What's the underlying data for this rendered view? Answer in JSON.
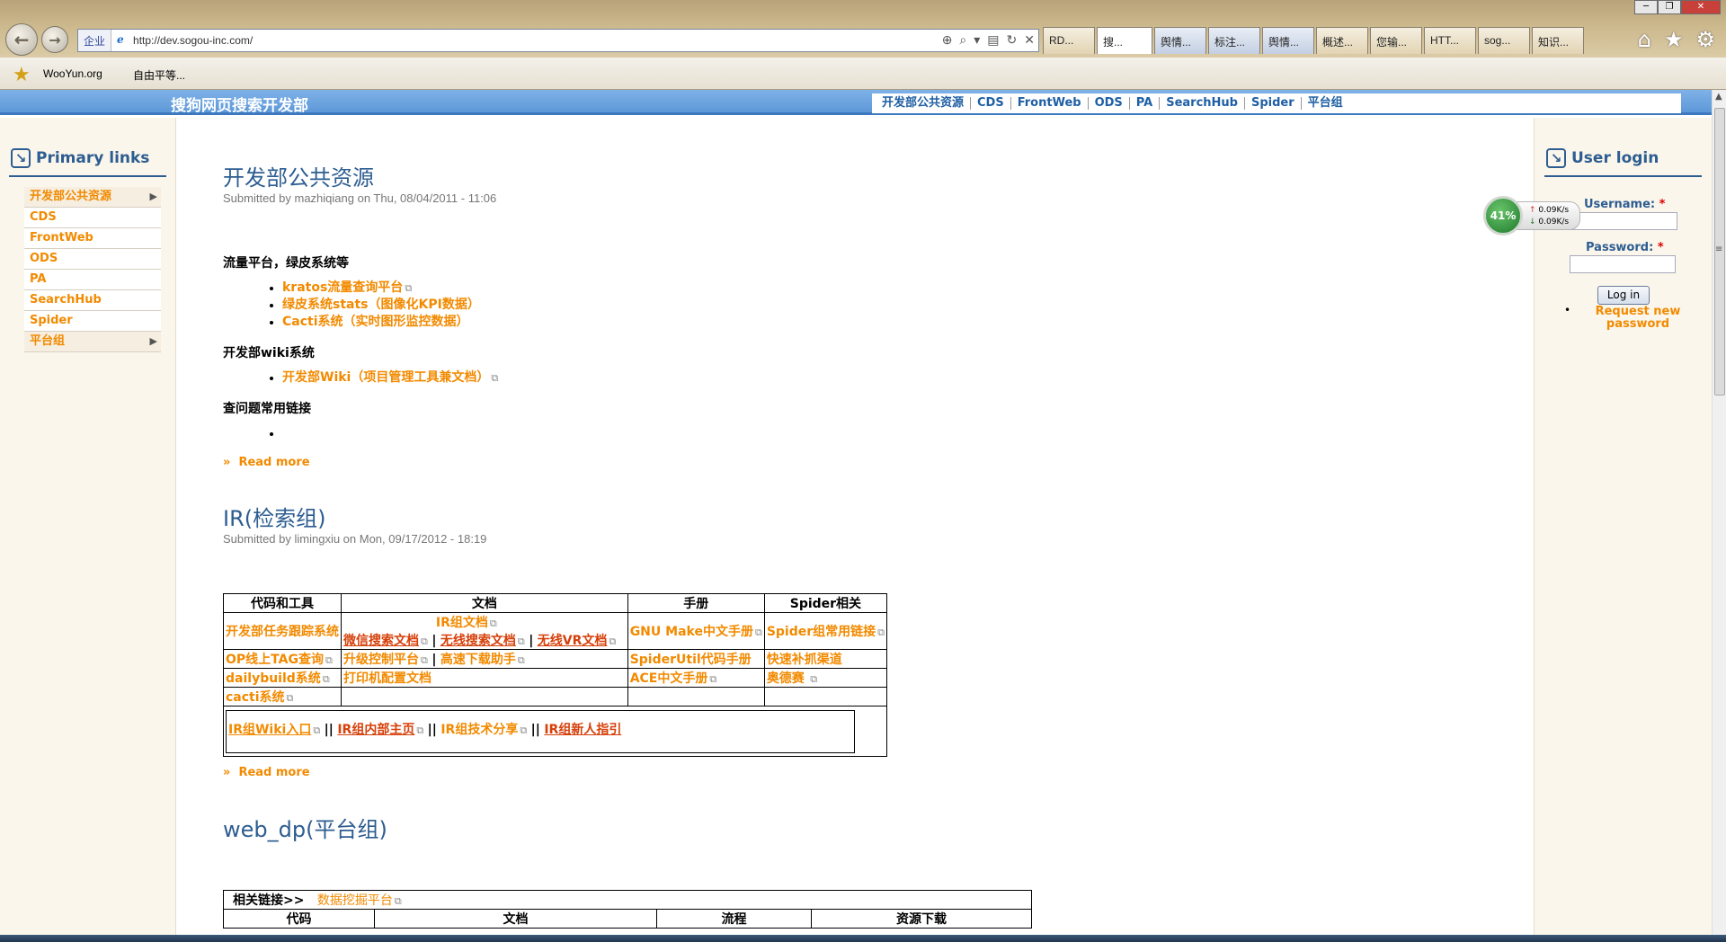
{
  "browser": {
    "address_zone": "企业",
    "url": "http://dev.sogou-inc.com/",
    "tabs": [
      "RD...",
      "搜...",
      "舆情...",
      "标注...",
      "舆情...",
      "概述...",
      "您输...",
      "HTT...",
      "sog...",
      "知识..."
    ],
    "favorites": [
      "WooYun.org",
      "自由平等..."
    ]
  },
  "site": {
    "title": "搜狗网页搜索开发部",
    "topnav": [
      "开发部公共资源",
      "CDS",
      "FrontWeb",
      "ODS",
      "PA",
      "SearchHub",
      "Spider",
      "平台组"
    ]
  },
  "primary_links": {
    "title": "Primary links",
    "items": [
      {
        "label": "开发部公共资源",
        "has_children": true
      },
      {
        "label": "CDS"
      },
      {
        "label": "FrontWeb"
      },
      {
        "label": "ODS"
      },
      {
        "label": "PA"
      },
      {
        "label": "SearchHub"
      },
      {
        "label": "Spider"
      },
      {
        "label": "平台组",
        "has_children": true
      }
    ]
  },
  "user_login": {
    "title": "User login",
    "username_label": "Username:",
    "password_label": "Password:",
    "required_mark": "*",
    "login_button": "Log in",
    "request_password_1": "Request new",
    "request_password_2": "password"
  },
  "netspeed": {
    "percent": "41%",
    "up": "0.09K/s",
    "down": "0.09K/s"
  },
  "nodes": [
    {
      "title": "开发部公共资源",
      "submitted": "Submitted by mazhiqiang on Thu, 08/04/2011 - 11:06",
      "sections": [
        {
          "label": "流量平台，绿皮系统等",
          "links": [
            "kratos流量查询平台",
            "绿皮系统stats（图像化KPI数据）",
            "Cacti系统（实时图形监控数据）"
          ]
        },
        {
          "label": "开发部wiki系统",
          "links": [
            "开发部Wiki（项目管理工具兼文档）"
          ]
        },
        {
          "label": "查问题常用链接",
          "links": [
            ""
          ]
        }
      ],
      "read_more": "Read more"
    },
    {
      "title": "IR(检索组)",
      "submitted": "Submitted by limingxiu on Mon, 09/17/2012 - 18:19",
      "table": {
        "headers": [
          "代码和工具",
          "文档",
          "手册",
          "Spider相关"
        ],
        "r1": {
          "c1": "开发部任务跟踪系统",
          "doc_top": "IR组文档",
          "doc_a": "微信搜索文档",
          "doc_b": "无线搜索文档",
          "doc_c": "无线VR文档",
          "c3": "GNU Make中文手册",
          "c4": "Spider组常用链接"
        },
        "r2": {
          "c1": "OP线上TAG查询",
          "doc_a": "升级控制平台",
          "doc_b": "高速下载助手",
          "c3": "SpiderUtil代码手册",
          "c4": "快速补抓渠道"
        },
        "r3": {
          "c1": "dailybuild系统",
          "doc_a": "打印机配置文档",
          "c3": "ACE中文手册",
          "c4": "奥德赛"
        },
        "r4": {
          "c1": "cacti系统"
        },
        "footer": [
          "IR组Wiki入口",
          "IR组内部主页",
          "IR组技术分享",
          "IR组新人指引"
        ],
        "sep_pipe": "|",
        "sep_double": "||"
      },
      "read_more": "Read more"
    },
    {
      "title_a": "web_dp",
      "title_b": "(平台组)",
      "related_label": "相关链接>>",
      "related_link": "数据挖掘平台",
      "headers": [
        "代码",
        "文档",
        "流程",
        "资源下载"
      ]
    }
  ]
}
